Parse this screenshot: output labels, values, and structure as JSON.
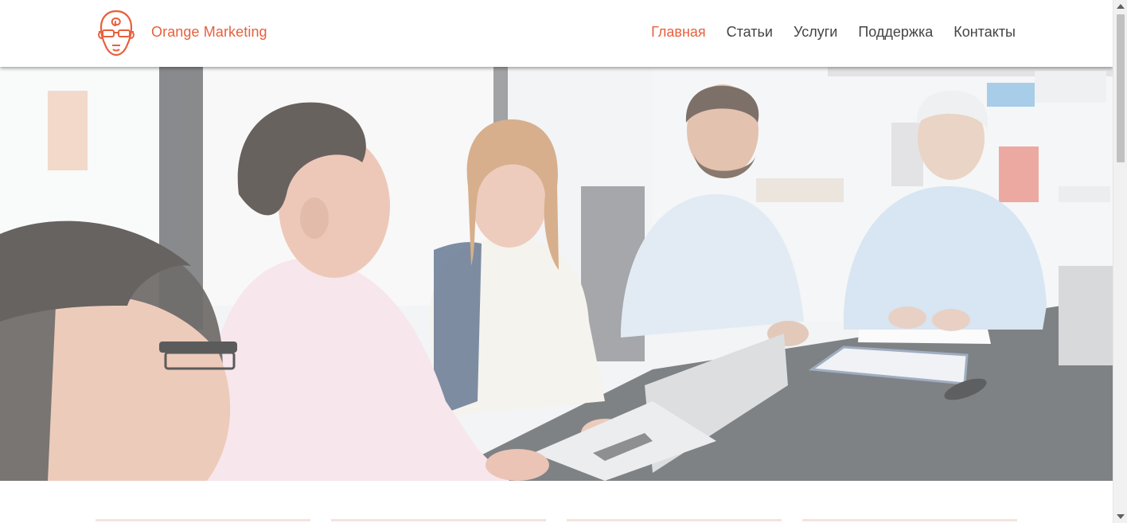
{
  "header": {
    "brand": "Orange Marketing",
    "logo_icon": "orange-marketer-head-icon",
    "nav": [
      {
        "label": "Главная",
        "active": true
      },
      {
        "label": "Статьи",
        "active": false
      },
      {
        "label": "Услуги",
        "active": false
      },
      {
        "label": "Поддержка",
        "active": false
      },
      {
        "label": "Контакты",
        "active": false
      }
    ]
  },
  "hero": {
    "image": "business-team-meeting-photo"
  },
  "colors": {
    "accent": "#e8603c",
    "nav_text": "#444444"
  }
}
